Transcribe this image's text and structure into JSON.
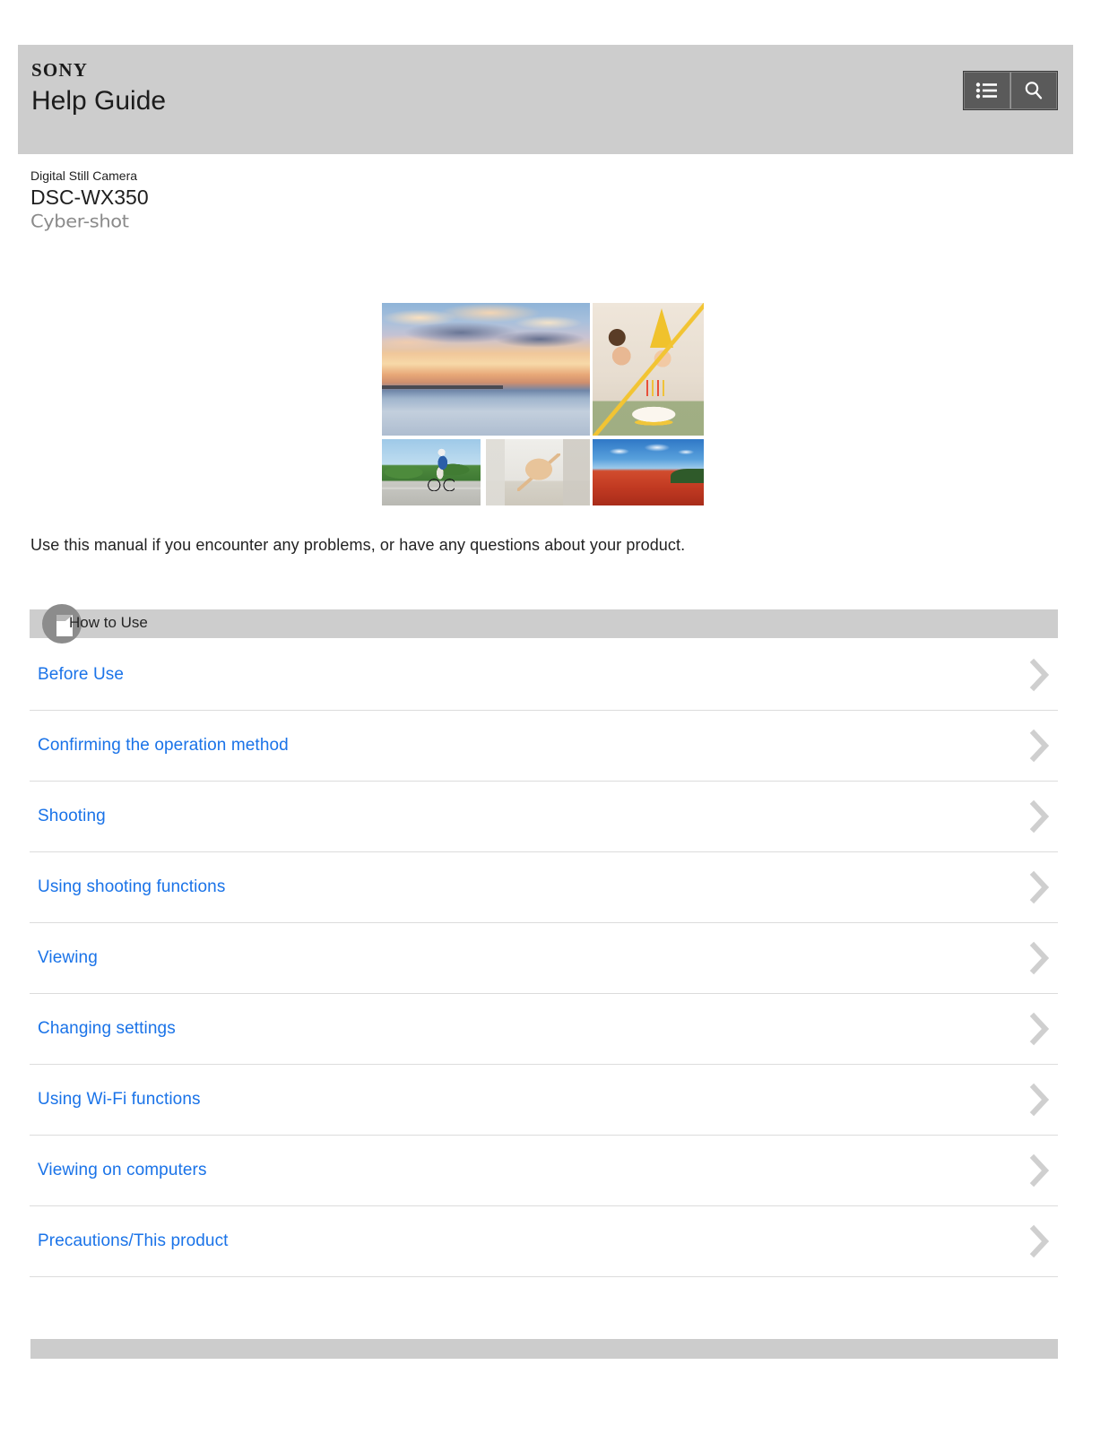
{
  "header": {
    "brand": "SONY",
    "title": "Help Guide",
    "buttons": [
      {
        "name": "list-icon",
        "label": "Contents list"
      },
      {
        "name": "search-icon",
        "label": "Search"
      }
    ]
  },
  "product": {
    "category": "Digital Still Camera",
    "model": "DSC-WX350",
    "series": "Cyber-shot"
  },
  "hero": {
    "alt": "Sample photo collage",
    "photos": [
      "sunset-beach-pier",
      "father-and-boy-birthday-cake",
      "cyclist-on-coastal-road",
      "cat-peeking-around-corner",
      "red-poppy-field-under-blue-sky"
    ]
  },
  "intro": "Use this manual if you encounter any problems, or have any questions about your product.",
  "section": {
    "label": "How to Use",
    "icon": "how-to-use-icon"
  },
  "menu": {
    "items": [
      {
        "label": "Before Use"
      },
      {
        "label": "Confirming the operation method"
      },
      {
        "label": "Shooting"
      },
      {
        "label": "Using shooting functions"
      },
      {
        "label": "Viewing"
      },
      {
        "label": "Changing settings"
      },
      {
        "label": "Using Wi-Fi functions"
      },
      {
        "label": "Viewing on computers"
      },
      {
        "label": "Precautions/This product"
      }
    ]
  },
  "colors": {
    "header_bg": "#cdcdcd",
    "link": "#1a73e8",
    "button_bg": "#5a5a5a",
    "chevron": "#cfcfcf",
    "divider": "#dcdcdc",
    "footer_bg": "#cccccc"
  }
}
